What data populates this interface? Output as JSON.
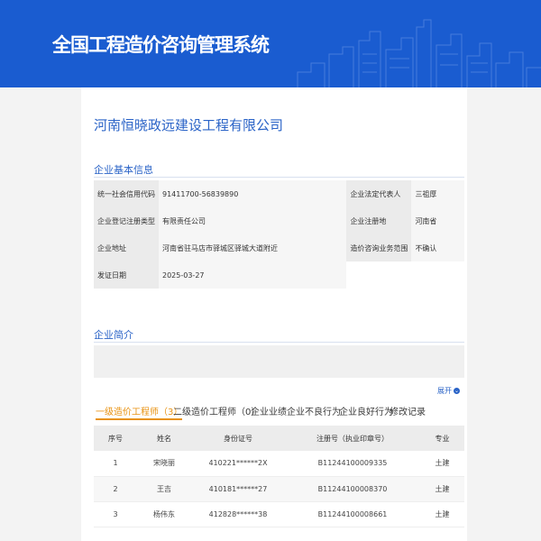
{
  "header": {
    "title": "全国工程造价咨询管理系统"
  },
  "company": {
    "name": "河南恒晓政远建设工程有限公司"
  },
  "basic_info": {
    "section_title": "企业基本信息",
    "rows": [
      {
        "label1": "统一社会信用代码",
        "value1": "91411700-56839890",
        "label2": "企业法定代表人",
        "value2": "三祖厚"
      },
      {
        "label1": "企业登记注册类型",
        "value1": "有限责任公司",
        "label2": "企业注册地",
        "value2": "河南省"
      },
      {
        "label1": "企业地址",
        "value1": "河南省驻马店市驿城区驿城大道附近",
        "label2": "造价咨询业务范围",
        "value2": "不确认"
      },
      {
        "label1": "发证日期",
        "value1": "2025-03-27",
        "label2": "",
        "value2": ""
      }
    ]
  },
  "intro": {
    "section_title": "企业简介",
    "text": "",
    "expand_label": "展开"
  },
  "tabs": [
    {
      "label": "一级造价工程师（3）",
      "active": true
    },
    {
      "label": "二级造价工程师（0）",
      "active": false
    },
    {
      "label": "企业业绩",
      "active": false
    },
    {
      "label": "企业不良行为",
      "active": false
    },
    {
      "label": "企业良好行为",
      "active": false
    },
    {
      "label": "修改记录",
      "active": false
    }
  ],
  "engineers": {
    "columns": [
      "序号",
      "姓名",
      "身份证号",
      "注册号（执业印章号）",
      "专业"
    ],
    "rows": [
      [
        "1",
        "宋晓丽",
        "410221******2X",
        "B11244100009335",
        "土建"
      ],
      [
        "2",
        "王吉",
        "410181******27",
        "B11244100008370",
        "土建"
      ],
      [
        "3",
        "杨伟东",
        "412828******38",
        "B11244100008661",
        "土建"
      ]
    ]
  },
  "colors": {
    "header_bg": "#1a5cd0",
    "accent_blue": "#2a63c7",
    "active_tab": "#e89211"
  }
}
